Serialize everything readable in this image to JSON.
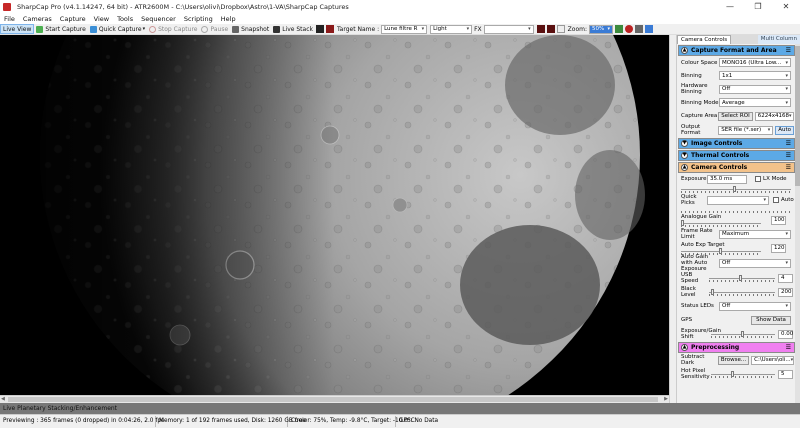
{
  "window": {
    "title": "SharpCap Pro (v4.1.14247, 64 bit) - ATR2600M - C:\\Users\\olivi\\Dropbox\\Astro\\1-VA\\SharpCap Captures",
    "minimize": "—",
    "maximize": "❐",
    "close": "✕"
  },
  "menu": [
    "File",
    "Cameras",
    "Capture",
    "View",
    "Tools",
    "Sequencer",
    "Scripting",
    "Help"
  ],
  "toolbar": {
    "live_view": "Live View",
    "start_capture": "Start Capture",
    "quick_capture": "Quick Capture",
    "stop_capture": "Stop Capture",
    "pause": "Pause",
    "snapshot": "Snapshot",
    "live_stack": "Live Stack",
    "target_name_label": "Target Name :",
    "target_name_value": "Lune filtre R",
    "light_value": "Light",
    "fx_label": "FX",
    "zoom_label": "Zoom:",
    "zoom_value": "50%"
  },
  "panel": {
    "tab_camera_controls": "Camera Controls",
    "tab_multi_column": "Multi Column",
    "sections": {
      "capture_format": "Capture Format and Area",
      "image_controls": "Image Controls",
      "thermal_controls": "Thermal Controls",
      "camera_controls": "Camera Controls",
      "preprocessing": "Preprocessing"
    },
    "colour_space_label": "Colour Space",
    "colour_space_value": "MONO16 (Ultra Low...",
    "binning_label": "Binning",
    "binning_value": "1x1",
    "hw_binning_label": "Hardware Binning",
    "hw_binning_value": "Off",
    "binning_mode_label": "Binning Mode",
    "binning_mode_value": "Average",
    "capture_area_label": "Capture Area",
    "select_roi": "Select ROI",
    "capture_area_value": "6224x4168",
    "output_format_label": "Output Format",
    "output_format_value": "SER file (*.ser)",
    "auto_label": "Auto",
    "exposure_label": "Exposure",
    "exposure_value": "35.0 ms",
    "lx_mode_label": "LX Mode",
    "quick_picks_label": "Quick Picks",
    "analogue_gain_label": "Analogue Gain",
    "analogue_gain_value": "100",
    "frame_rate_label": "Frame Rate Limit",
    "frame_rate_value": "Maximum",
    "auto_exp_target_label": "Auto Exp Target",
    "auto_exp_target_value": "120",
    "auto_gain_label": "Auto Gain with Auto Exposure",
    "auto_gain_value": "Off",
    "usb_speed_label": "USB Speed",
    "usb_speed_value": "4",
    "black_level_label": "Black Level",
    "black_level_value": "200",
    "status_leds_label": "Status LEDs",
    "status_leds_value": "Off",
    "gps_label": "GPS",
    "show_data": "Show Data",
    "exp_gain_shift_label": "Exposure/Gain Shift",
    "exp_gain_shift_value": "0.00",
    "subtract_dark_label": "Subtract Dark",
    "browse": "Browse...",
    "subtract_dark_value": "C:\\Users\\oli...",
    "hot_pixel_label": "Hot Pixel Sensitivity",
    "hot_pixel_value": "5"
  },
  "processing_bar": "Live Planetary Stacking/Enhancement",
  "status": {
    "previewing": "Previewing : 365 frames (0 dropped) in 0:04:26, 2.0 fps",
    "memory": "Memory: 1 of 192 frames used, Disk: 1260 GB free",
    "cooler": "Cooler: 75%, Temp: -9.8°C, Target: -10.0°C",
    "gps": "GPS: No Data"
  },
  "icons": {
    "app": "sharpcap-icon",
    "live_view_color": "#cde4f7",
    "section_blue": "#5ca9e6",
    "section_beige": "#f3c28a",
    "section_pink": "#f07ff0"
  }
}
